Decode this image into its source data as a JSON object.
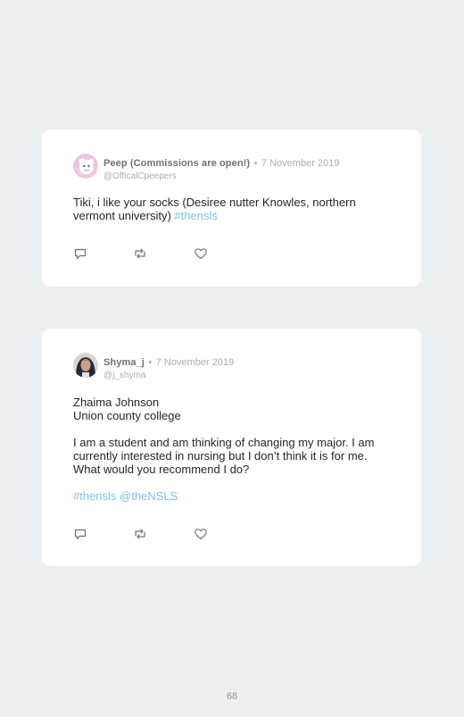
{
  "tweets": [
    {
      "name": "Peep (Commissions are open!)",
      "separator": "•",
      "date": "7 November 2019",
      "handle": "@OfficalCpeepers",
      "body": "Tiki, i like your socks (Desiree nutter Knowles, northern vermont university) ",
      "hashtag": "#thensls",
      "avatar_icon": "cartoon-character-avatar",
      "avatar_color": "#efc6dc"
    },
    {
      "name": "Shyma_j",
      "separator": "•",
      "date": "7 November 2019",
      "handle": "@j_shyma",
      "lines": [
        "Zhaima Johnson",
        "Union county college",
        "I am a student and am thinking of changing my major. I am currently interested in nursing but I don’t think it is for me. What would you recommend I do?"
      ],
      "hashtags": "#thensls @theNSLS",
      "avatar_icon": "user-photo-avatar",
      "avatar_color": "#2b2a33"
    }
  ],
  "actions": [
    "reply-icon",
    "retweet-icon",
    "like-icon"
  ],
  "colors": {
    "background": "#eceef2",
    "card": "#ffffff",
    "link": "#7fc3df",
    "muted": "#a9adb5"
  },
  "page_number": "68"
}
